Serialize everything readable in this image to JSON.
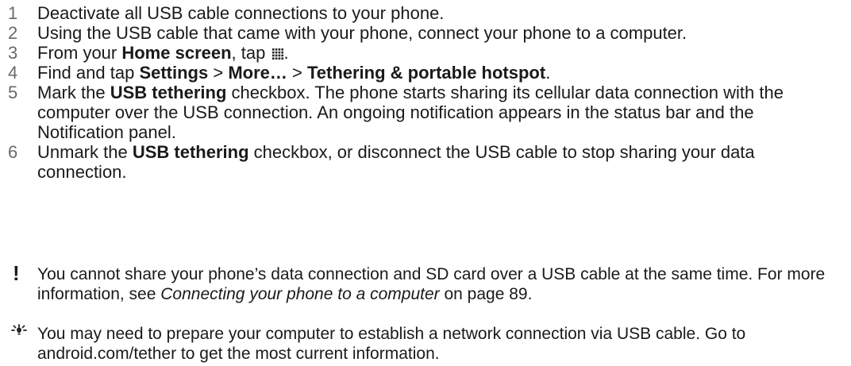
{
  "steps": [
    {
      "num": "1",
      "text": "Deactivate all USB cable connections to your phone."
    },
    {
      "num": "2",
      "text": "Using the USB cable that came with your phone, connect your phone to a computer."
    },
    {
      "num": "3",
      "before": "From your ",
      "bold1": "Home screen",
      "after": ", tap "
    },
    {
      "num": "4",
      "before": "Find and tap ",
      "bold1": "Settings",
      "sep1": " > ",
      "bold2": "More…",
      "sep2": " > ",
      "bold3": "Tethering & portable hotspot",
      "after": "."
    },
    {
      "num": "5",
      "before": "Mark the ",
      "bold1": "USB tethering",
      "after": " checkbox. The phone starts sharing its cellular data connection with the computer over the USB connection. An ongoing notification appears in the status bar and the Notification panel."
    },
    {
      "num": "6",
      "before": "Unmark the ",
      "bold1": "USB tethering",
      "after": " checkbox, or disconnect the USB cable to stop sharing your data connection."
    }
  ],
  "warning": {
    "icon": "exclamation-icon",
    "before": "You cannot share your phone’s data connection and SD card over a USB cable at the same time. For more information, see ",
    "link": "Connecting your phone to a computer",
    "after": " on page 89."
  },
  "tip": {
    "icon": "lightbulb-tip-icon",
    "text": "You may need to prepare your computer to establish a network connection via USB cable. Go to android.com/tether to get the most current information."
  },
  "step3_icon": "app-grid-icon",
  "step3_period": "."
}
